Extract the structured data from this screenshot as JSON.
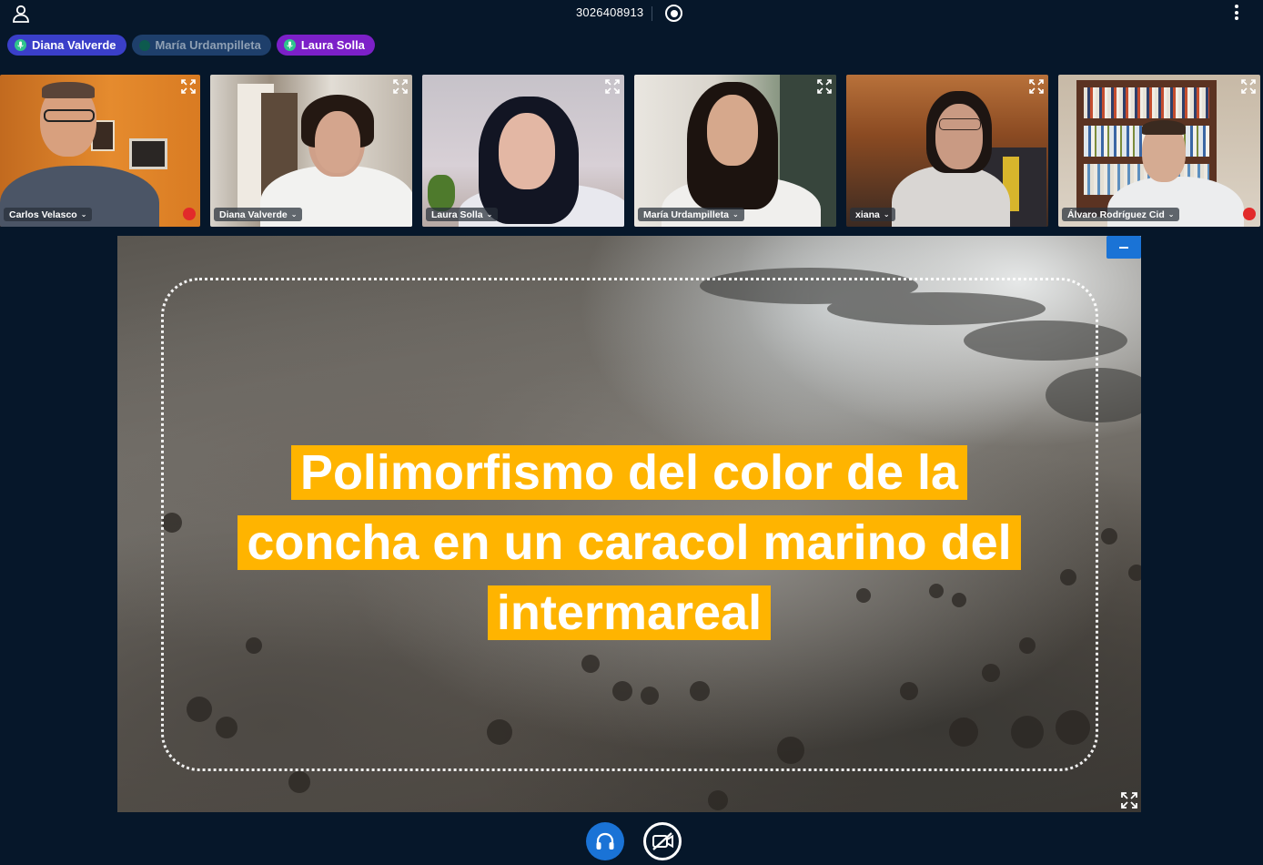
{
  "topbar": {
    "user_icon": "user-icon",
    "meeting_id": "3026408913",
    "record_icon": "record-icon",
    "options_icon": "kebab-menu-icon"
  },
  "talking_indicators": [
    {
      "name": "Diana Valverde",
      "color": "#3a3fc9",
      "state": "talking"
    },
    {
      "name": "María Urdampilleta",
      "color": "#1e3f6b",
      "state": "muted"
    },
    {
      "name": "Laura Solla",
      "color": "#7c20c8",
      "state": "talking"
    }
  ],
  "webcams": [
    {
      "name": "Carlos Velasco",
      "muted": true
    },
    {
      "name": "Diana Valverde",
      "muted": false
    },
    {
      "name": "Laura Solla",
      "muted": false
    },
    {
      "name": "María Urdampilleta",
      "muted": false
    },
    {
      "name": "xiana",
      "muted": false
    },
    {
      "name": "Álvaro Rodríguez Cid",
      "muted": true
    }
  ],
  "presentation": {
    "title_lines": [
      "Polimorfismo del color de la",
      "concha en un caracol marino del",
      "intermareal"
    ],
    "highlight_color": "#ffb400",
    "minimize_icon": "minimize-icon",
    "fullscreen_icon": "fullscreen-icon"
  },
  "actions": {
    "audio_icon": "headphones-icon",
    "video_icon": "video-off-icon",
    "audio_color": "#1a73d6"
  }
}
